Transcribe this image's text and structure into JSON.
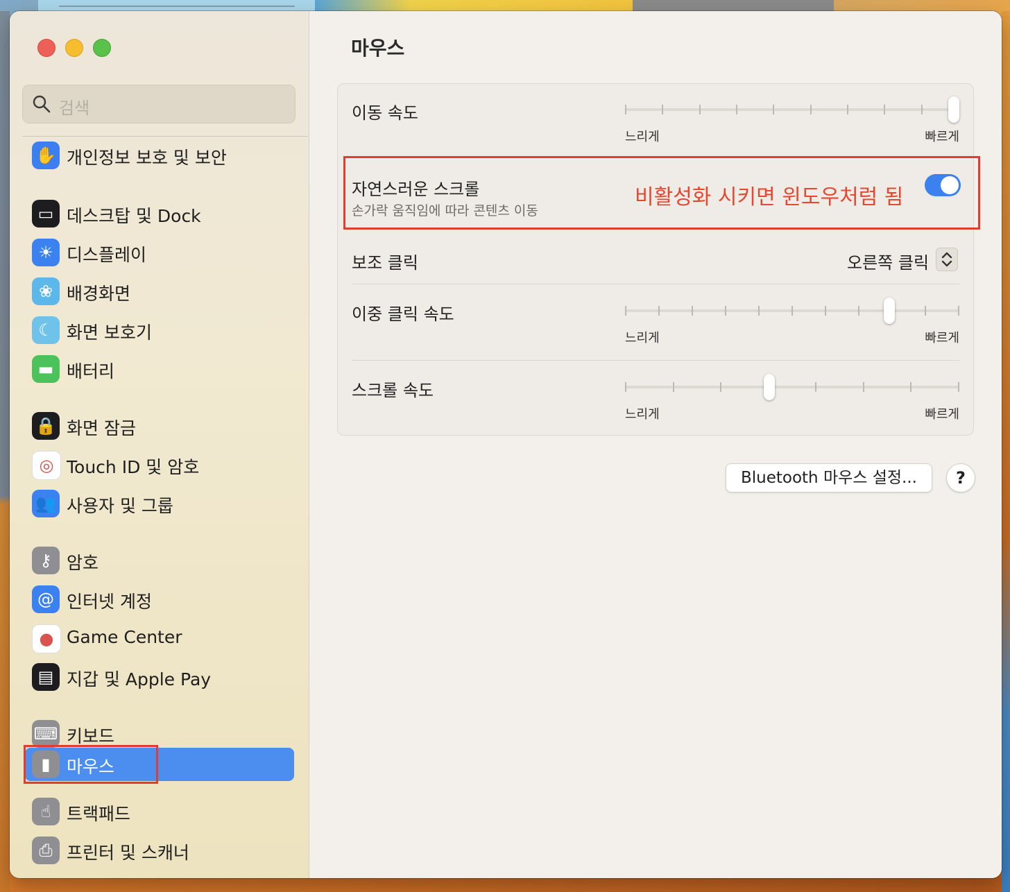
{
  "window_title": "마우스",
  "search": {
    "placeholder": "검색"
  },
  "sidebar": {
    "items": [
      {
        "label": "개인정보 보호 및 보안",
        "icon": "hand-icon",
        "color": "#3b7ff0"
      },
      {
        "label": "데스크탑 및 Dock",
        "icon": "dock-icon",
        "color": "#1d1d1f"
      },
      {
        "label": "디스플레이",
        "icon": "sun-icon",
        "color": "#3b82f0"
      },
      {
        "label": "배경화면",
        "icon": "flower-icon",
        "color": "#5cb8ea"
      },
      {
        "label": "화면 보호기",
        "icon": "screensaver-icon",
        "color": "#6fc3ea"
      },
      {
        "label": "배터리",
        "icon": "battery-icon",
        "color": "#4cc25a"
      },
      {
        "label": "화면 잠금",
        "icon": "lock-icon",
        "color": "#1d1d1f"
      },
      {
        "label": "Touch ID 및 암호",
        "icon": "fingerprint-icon",
        "color": "#ffffff"
      },
      {
        "label": "사용자 및 그룹",
        "icon": "users-icon",
        "color": "#3b82f0"
      },
      {
        "label": "암호",
        "icon": "key-icon",
        "color": "#8e8e93"
      },
      {
        "label": "인터넷 계정",
        "icon": "at-icon",
        "color": "#3b82f0"
      },
      {
        "label": "Game Center",
        "icon": "game-center-icon",
        "color": "#ffffff"
      },
      {
        "label": "지갑 및 Apple Pay",
        "icon": "wallet-icon",
        "color": "#1d1d1f"
      },
      {
        "label": "키보드",
        "icon": "keyboard-icon",
        "color": "#8e8e93"
      },
      {
        "label": "마우스",
        "icon": "mouse-icon",
        "color": "#8e8e93",
        "selected": true
      },
      {
        "label": "트랙패드",
        "icon": "trackpad-icon",
        "color": "#8e8e93"
      },
      {
        "label": "프린터 및 스캐너",
        "icon": "printer-icon",
        "color": "#8e8e93"
      }
    ]
  },
  "main": {
    "title": "마우스",
    "tracking_speed": {
      "label": "이동 속도",
      "min_label": "느리게",
      "max_label": "빠르게",
      "value_fraction": 1.0
    },
    "natural_scroll": {
      "label": "자연스러운 스크롤",
      "description": "손가락 움직임에 따라 콘텐츠 이동",
      "enabled": true,
      "annotation": "비활성화 시키면 윈도우처럼 됨"
    },
    "secondary_click": {
      "label": "보조 클릭",
      "value": "오른쪽 클릭"
    },
    "double_click_speed": {
      "label": "이중 클릭 속도",
      "min_label": "느리게",
      "max_label": "빠르게",
      "value_fraction": 0.8
    },
    "scroll_speed": {
      "label": "스크롤 속도",
      "min_label": "느리게",
      "max_label": "빠르게",
      "value_fraction": 0.43
    },
    "bluetooth_button": "Bluetooth 마우스 설정...",
    "help_button": "?"
  },
  "accent_color": "#3b82f0",
  "annotation_color": "#e03c2f"
}
